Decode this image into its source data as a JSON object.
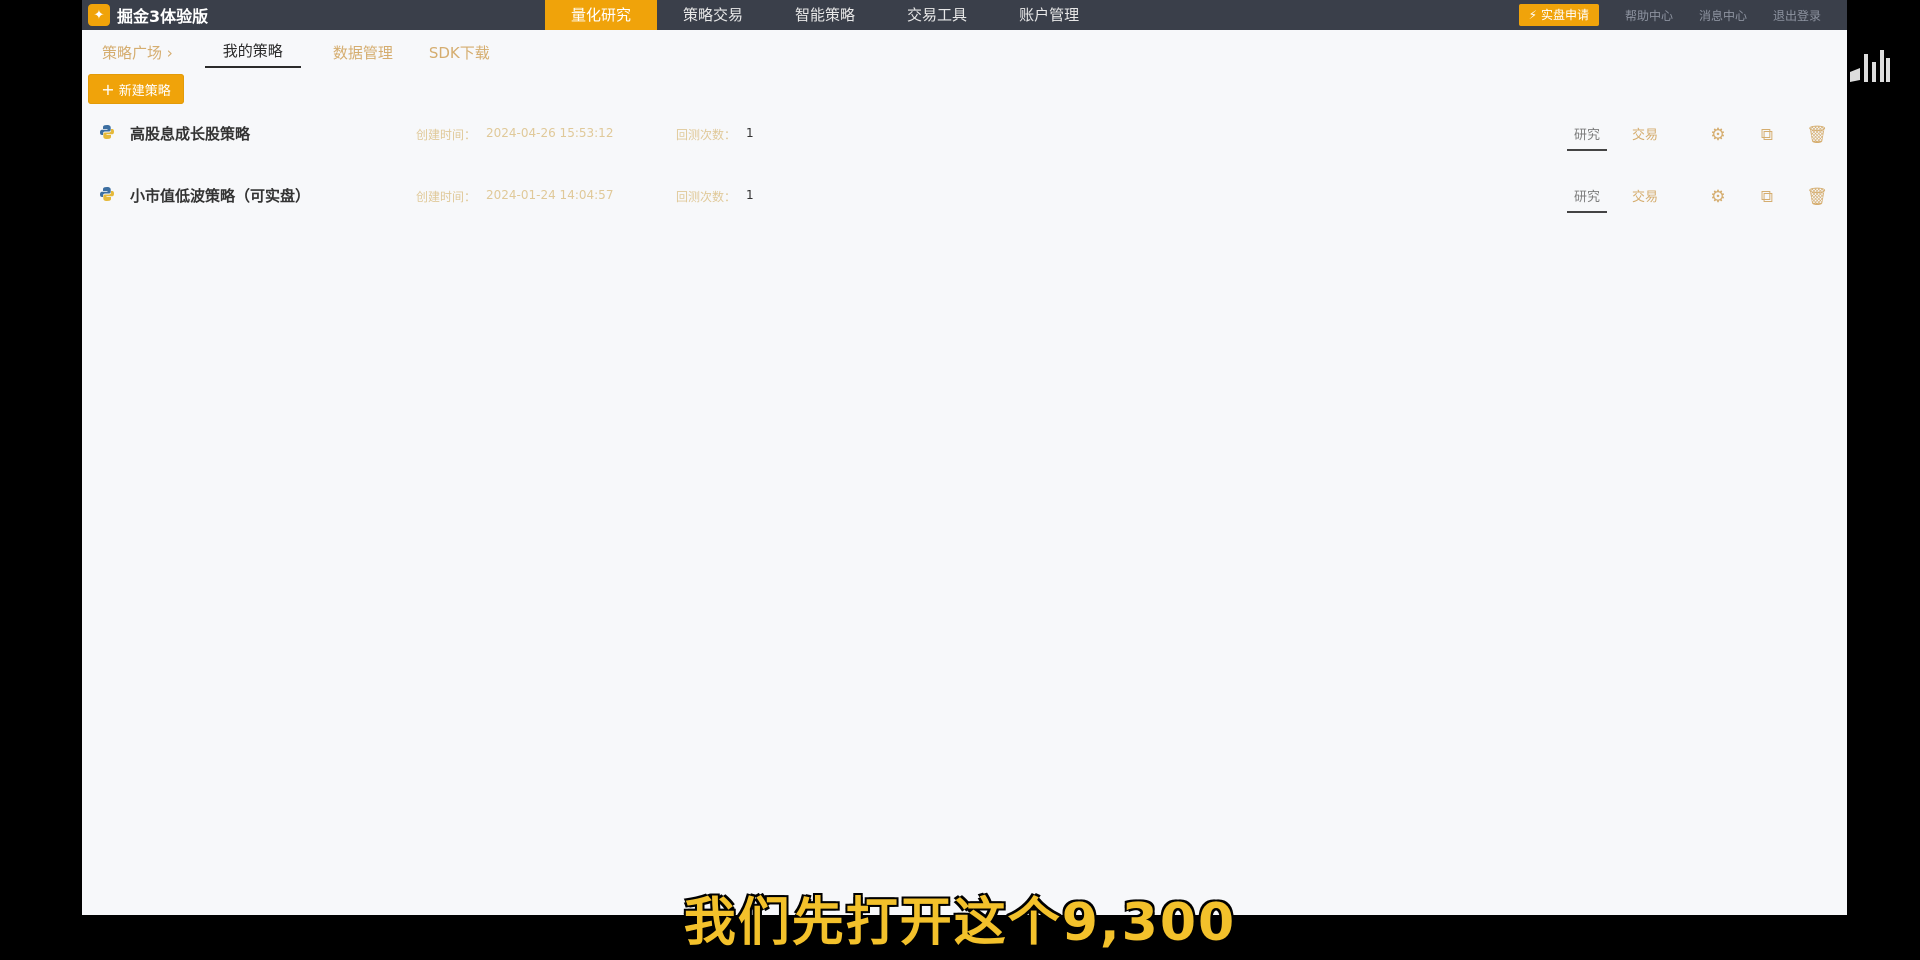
{
  "app": {
    "brand": "掘金3体验版",
    "colors": {
      "accent": "#f0a30a",
      "topbar": "#3a3f4a",
      "background": "#f7f8fa"
    }
  },
  "main_nav": [
    {
      "label": "量化研究",
      "active": true
    },
    {
      "label": "策略交易",
      "active": false
    },
    {
      "label": "智能策略",
      "active": false
    },
    {
      "label": "交易工具",
      "active": false
    },
    {
      "label": "账户管理",
      "active": false
    }
  ],
  "top_right": {
    "live_label": "实盘申请",
    "links": [
      "帮助中心",
      "消息中心",
      "退出登录"
    ]
  },
  "subtabs": [
    {
      "label": "策略广场",
      "active": false
    },
    {
      "label": "我的策略",
      "active": true
    },
    {
      "label": "数据管理",
      "active": false
    },
    {
      "label": "SDK下载",
      "active": false
    }
  ],
  "new_strategy_label": "新建策略",
  "strategies": [
    {
      "name": "高股息成长股策略",
      "created_label": "创建时间：",
      "created": "2024-04-26 15:53:12",
      "count_label": "回测次数：",
      "count": "1",
      "research_label": "研究",
      "trade_label": "交易"
    },
    {
      "name": "小市值低波策略（可实盘）",
      "created_label": "创建时间：",
      "created": "2024-01-24 14:04:57",
      "count_label": "回测次数：",
      "count": "1",
      "research_label": "研究",
      "trade_label": "交易"
    }
  ],
  "subtitle": "我们先打开这个9,300"
}
